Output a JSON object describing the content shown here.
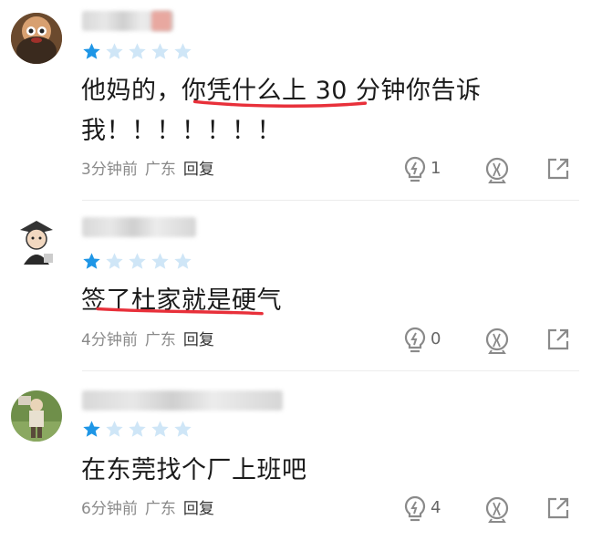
{
  "comments": [
    {
      "rating": 1,
      "text_line1_a": "他妈的，",
      "text_line1_b": "你凭什么上 30 分钟你告诉",
      "text_line2": "我！！！！！！！",
      "time": "3分钟前",
      "location": "广东",
      "reply_label": "回复",
      "likes": "1"
    },
    {
      "rating": 1,
      "text": "签了杜家就是硬气",
      "time": "4分钟前",
      "location": "广东",
      "reply_label": "回复",
      "likes": "0"
    },
    {
      "rating": 1,
      "text": "在东莞找个厂上班吧",
      "time": "6分钟前",
      "location": "广东",
      "reply_label": "回复",
      "likes": "4"
    }
  ],
  "colors": {
    "star_filled": "#1e96e6",
    "star_empty": "#cfe6f7",
    "underline": "#e8303a",
    "icon": "#8a8a8a"
  },
  "icons": [
    "lightbulb-icon",
    "stamp-icon",
    "share-icon"
  ]
}
